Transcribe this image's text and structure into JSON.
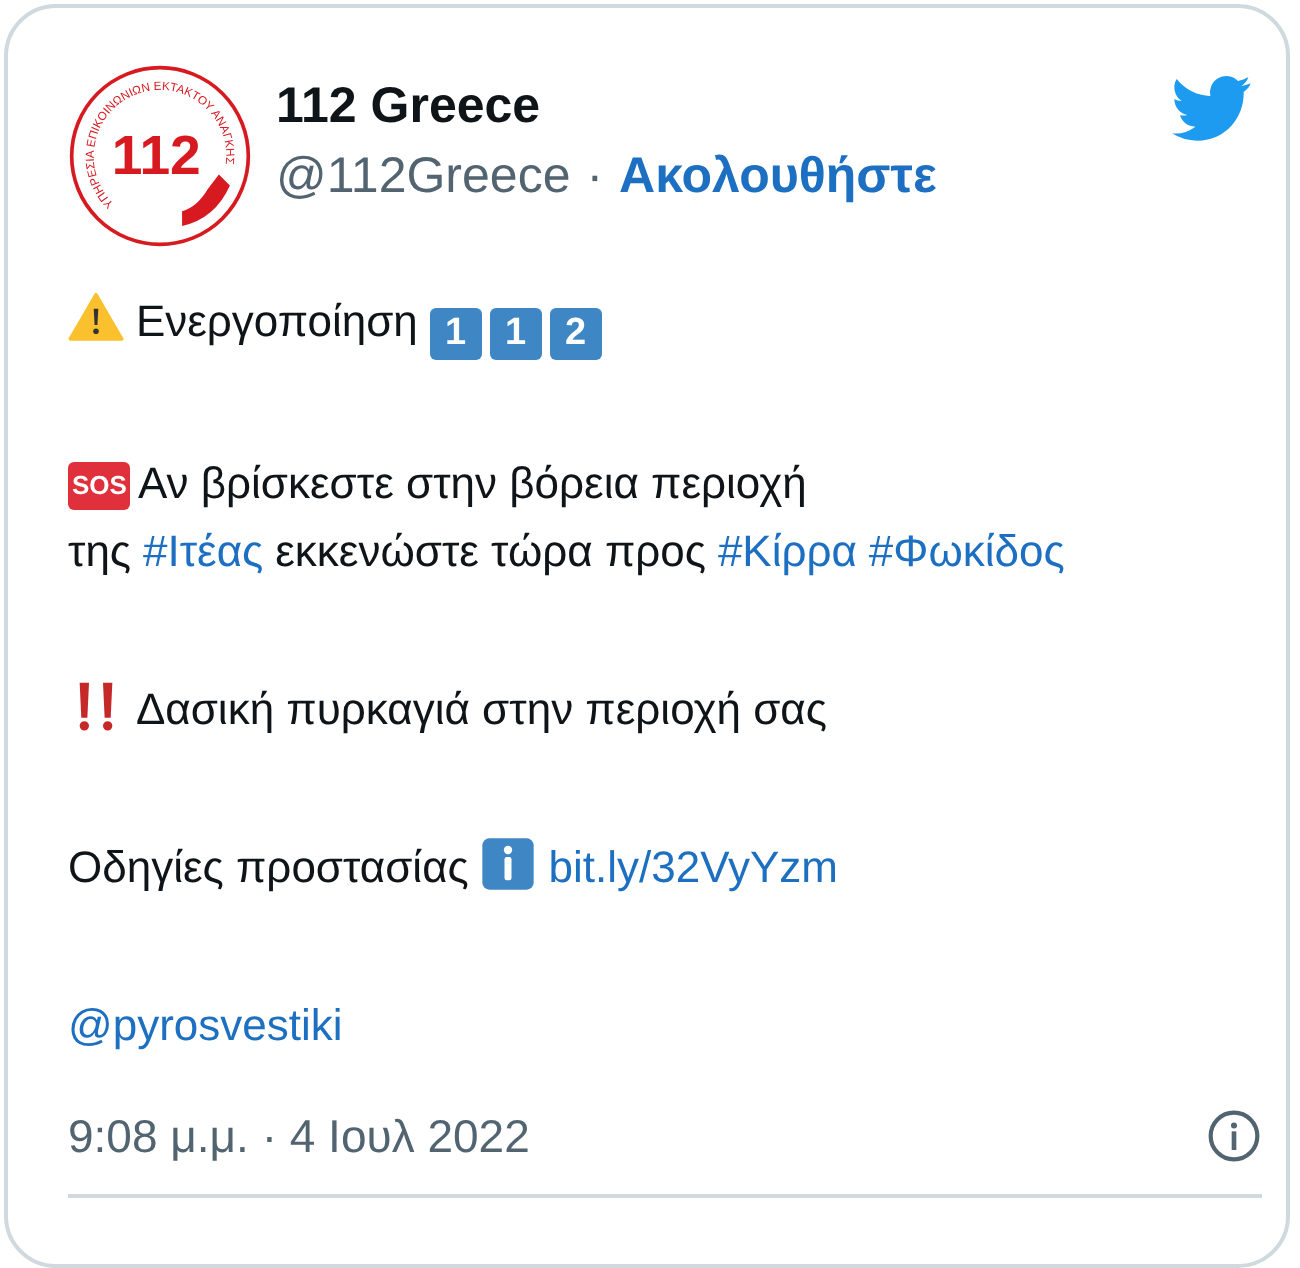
{
  "author": {
    "avatar": {
      "number": "112",
      "ring_text": "ΥΠΗΡΕΣΙΑ ΕΠΙΚΟΙΝΩΝΙΩΝ ΕΚΤΑΚΤΟΥ ΑΝΑΓΚΗΣ"
    },
    "name": "112 Greece",
    "handle": "@112Greece",
    "separator": "·",
    "follow": "Ακολουθήστε"
  },
  "paragraphs": [
    [
      {
        "kind": "warning"
      },
      {
        "kind": "text",
        "text": "Ενεργοποίηση"
      },
      {
        "kind": "keycap",
        "text": "1"
      },
      {
        "kind": "keycap",
        "text": "1"
      },
      {
        "kind": "keycap",
        "text": "2"
      }
    ],
    [
      {
        "kind": "sos",
        "text": "SOS"
      },
      {
        "kind": "text",
        "text": "Αν βρίσκεστε στην βόρεια περιοχή της"
      },
      {
        "kind": "hashtag",
        "text": "#Ιτέας"
      },
      {
        "kind": "text",
        "text": "εκκενώστε τώρα προς"
      },
      {
        "kind": "hashtag",
        "text": "#Κίρρα"
      },
      {
        "kind": "hashtag",
        "text": "#Φωκίδος"
      }
    ],
    [
      {
        "kind": "exclamation"
      },
      {
        "kind": "text",
        "text": "Δασική πυρκαγιά στην περιοχή σας"
      }
    ],
    [
      {
        "kind": "text",
        "text": "Οδηγίες προστασίας"
      },
      {
        "kind": "info"
      },
      {
        "kind": "link",
        "text": "bit.ly/32VyYzm"
      }
    ],
    [
      {
        "kind": "mention",
        "text": "@pyrosvestiki"
      }
    ]
  ],
  "timestamp": "9:08 μ.μ. · 4 Ιουλ 2022"
}
